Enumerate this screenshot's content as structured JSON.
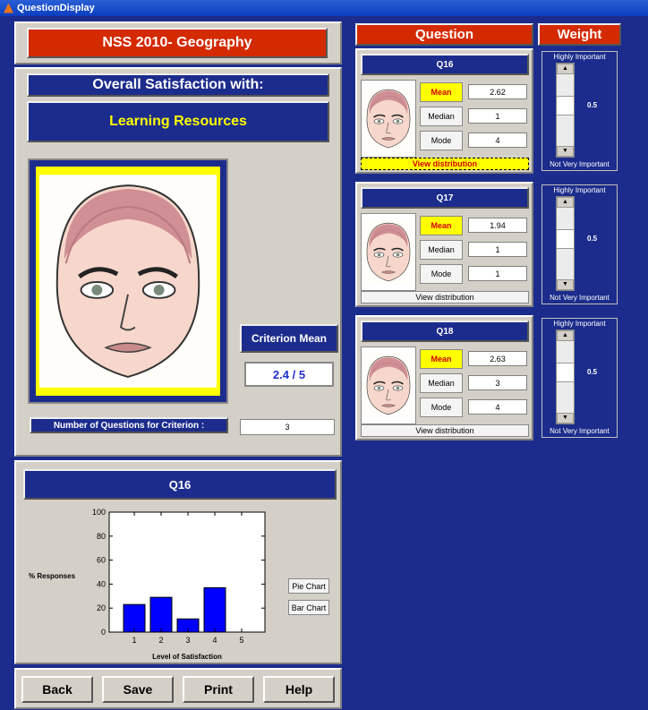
{
  "window": {
    "title": "QuestionDisplay"
  },
  "header": {
    "course_title": "NSS 2010- Geography",
    "overall_label": "Overall Satisfaction with:",
    "criterion_name": "Learning Resources"
  },
  "criterion": {
    "mean_label": "Criterion Mean",
    "mean_value": "2.4 / 5",
    "num_questions_label": "Number of Questions for Criterion :",
    "num_questions_value": "3"
  },
  "columns": {
    "question": "Question",
    "weight": "Weight"
  },
  "questions": [
    {
      "id": "Q16",
      "mean": "2.62",
      "median": "1",
      "mode": "4",
      "weight": "0.5",
      "weight_fraction": 0.5,
      "view_label": "View distribution",
      "selected": true
    },
    {
      "id": "Q17",
      "mean": "1.94",
      "median": "1",
      "mode": "1",
      "weight": "0.5",
      "weight_fraction": 0.5,
      "view_label": "View distribution",
      "selected": false
    },
    {
      "id": "Q18",
      "mean": "2.63",
      "median": "3",
      "mode": "4",
      "weight": "0.5",
      "weight_fraction": 0.5,
      "view_label": "View distribution",
      "selected": false
    }
  ],
  "stat_labels": {
    "mean": "Mean",
    "median": "Median",
    "mode": "Mode"
  },
  "weight_labels": {
    "high": "Highly Important",
    "low": "Not Very Important"
  },
  "distribution": {
    "title": "Q16",
    "pie_button": "Pie Chart",
    "bar_button": "Bar Chart"
  },
  "chart_data": {
    "type": "bar",
    "categories": [
      "1",
      "2",
      "3",
      "4",
      "5"
    ],
    "values": [
      23,
      29,
      11,
      37,
      0
    ],
    "title": "",
    "xlabel": "Level of Satisfaction",
    "ylabel": "% Responses",
    "ylim": [
      0,
      100
    ],
    "yticks": [
      "0",
      "20",
      "40",
      "60",
      "80",
      "100"
    ],
    "bar_color": "#0000ff"
  },
  "footer": {
    "back": "Back",
    "save": "Save",
    "print": "Print",
    "help": "Help"
  },
  "colors": {
    "background": "#1c2c8c",
    "accent_red": "#d42a00",
    "panel_gray": "#d4d0c8",
    "highlight_yellow": "#ffff00"
  }
}
